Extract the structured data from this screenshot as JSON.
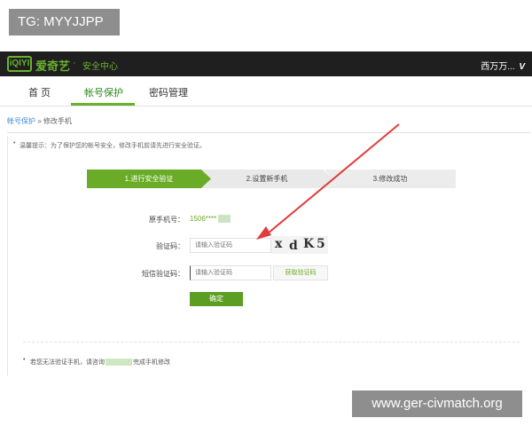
{
  "watermark_top": "TG: MYYJJPP",
  "watermark_bottom": "www.ger-civmatch.org",
  "header": {
    "logo_text": "iQIYI",
    "brand": "爱奇艺",
    "sub_brand": "安全中心",
    "user_name": "西万万...",
    "user_mark": "V"
  },
  "nav": {
    "items": [
      {
        "label": "首 页"
      },
      {
        "label": "帐号保护"
      },
      {
        "label": "密码管理"
      }
    ]
  },
  "breadcrumb": {
    "parent": "帐号保护",
    "separator": "»",
    "current": "修改手机"
  },
  "tip": "温馨提示：为了保护您的帐号安全，修改手机前请先进行安全验证。",
  "steps": [
    {
      "label": "1.进行安全验证"
    },
    {
      "label": "2.设置新手机"
    },
    {
      "label": "3.修改成功"
    }
  ],
  "form": {
    "phone_label": "原手机号：",
    "phone_value": "1506****",
    "captcha_label": "验证码：",
    "captcha_placeholder": "请输入验证码",
    "captcha_chars": [
      "x",
      "d",
      "K",
      "5"
    ],
    "sms_label": "短信验证码：",
    "sms_placeholder": "请输入验证码",
    "sms_button": "获取验证码",
    "confirm_button": "确定"
  },
  "help": {
    "prefix": "若您无法验证手机，请咨询",
    "suffix": "完成手机修改"
  },
  "colors": {
    "accent": "#6aac27",
    "topbar": "#1f1f1f",
    "arrow": "#e23b3b"
  }
}
